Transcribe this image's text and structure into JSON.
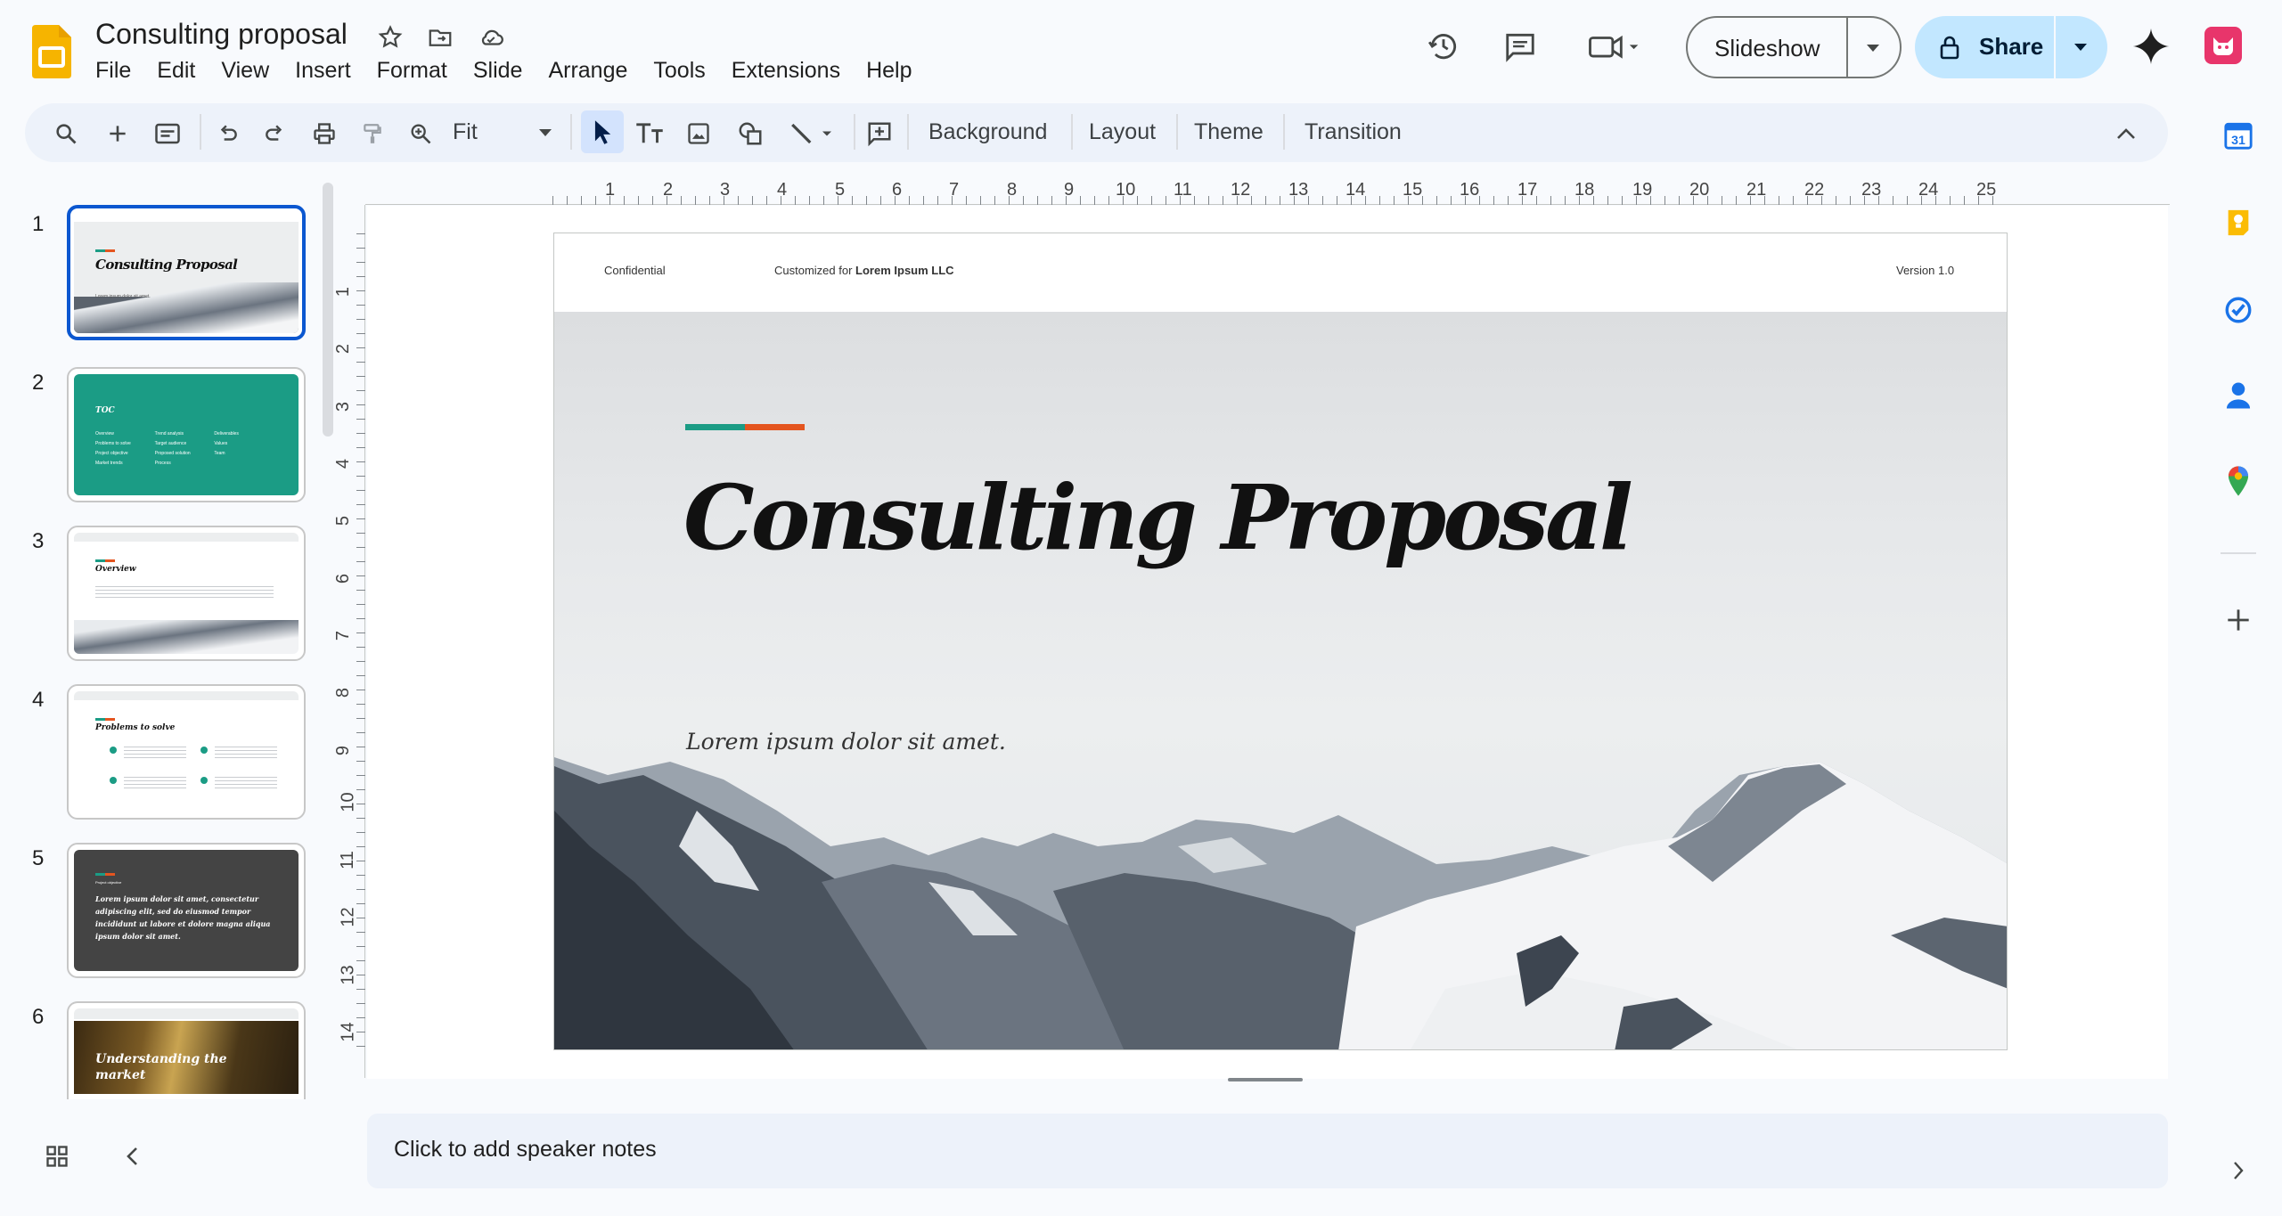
{
  "doc": {
    "title": "Consulting proposal"
  },
  "menu": [
    "File",
    "Edit",
    "View",
    "Insert",
    "Format",
    "Slide",
    "Arrange",
    "Tools",
    "Extensions",
    "Help"
  ],
  "header": {
    "slideshow_label": "Slideshow",
    "share_label": "Share"
  },
  "toolbar": {
    "zoom_value": "Fit",
    "background_label": "Background",
    "layout_label": "Layout",
    "theme_label": "Theme",
    "transition_label": "Transition"
  },
  "ruler": {
    "horizontal": [
      "1",
      "2",
      "3",
      "4",
      "5",
      "6",
      "7",
      "8",
      "9",
      "10",
      "11",
      "12",
      "13",
      "14",
      "15",
      "16",
      "17",
      "18",
      "19",
      "20",
      "21",
      "22",
      "23",
      "24",
      "25"
    ],
    "vertical": [
      "1",
      "2",
      "3",
      "4",
      "5",
      "6",
      "7",
      "8",
      "9",
      "10",
      "11",
      "12",
      "13",
      "14"
    ]
  },
  "filmstrip": {
    "numbers": [
      "1",
      "2",
      "3",
      "4",
      "5",
      "6"
    ],
    "slide1_title": "Consulting Proposal",
    "slide1_sub": "Lorem ipsum dolor sit amet.",
    "slide2_title": "TOC",
    "slide2_items": [
      "Overview",
      "Problems to solve",
      "Project objective",
      "Market trends",
      "Trend analysis",
      "Target audience",
      "Proposed solution",
      "Process",
      "Deliverables",
      "Values",
      "Team"
    ],
    "slide3_title": "Overview",
    "slide4_title": "Problems to solve",
    "slide5_label": "Project objective",
    "slide5_quote": "Lorem ipsum dolor sit amet, consectetur adipiscing elit, sed do eiusmod tempor incididunt ut labore et dolore magna aliqua ipsum dolor sit amet.",
    "slide6_title": "Understanding the market"
  },
  "slide": {
    "confidential": "Confidential",
    "customized_prefix": "Customized for",
    "customized_name": "Lorem Ipsum LLC",
    "version": "Version 1.0",
    "title": "Consulting Proposal",
    "subtitle": "Lorem ipsum dolor sit amet."
  },
  "notes": {
    "placeholder": "Click to add speaker notes"
  },
  "colors": {
    "accent_teal": "#1b9c85",
    "accent_orange": "#e4551f",
    "share_bg": "#c2e7ff",
    "selection": "#0b57d0"
  }
}
